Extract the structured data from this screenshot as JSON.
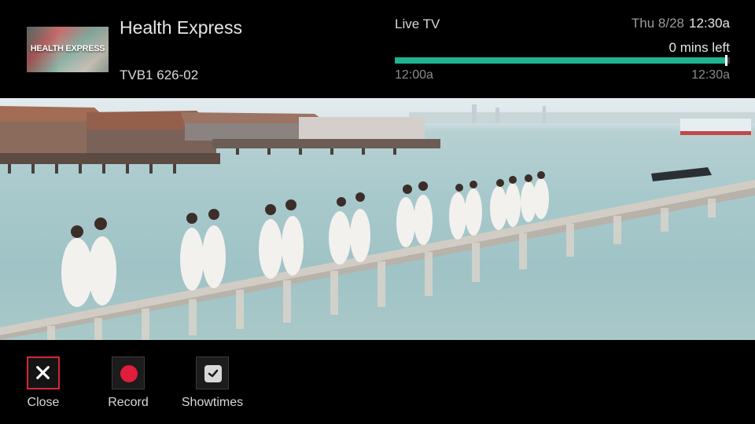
{
  "header": {
    "thumbnail_text": "HEALTH EXPRESS",
    "show_title": "Health Express",
    "channel_info": "TVB1 626-02",
    "live_label": "Live TV",
    "date": "Thu 8/28",
    "time": "12:30a",
    "remaining": "0 mins left",
    "start_time": "12:00a",
    "end_time": "12:30a",
    "progress": 0.99
  },
  "video": {
    "icon": "live-video-frame"
  },
  "actions": [
    {
      "label": "Close",
      "icon": "close-icon",
      "selected": true
    },
    {
      "label": "Record",
      "icon": "record-icon",
      "selected": false
    },
    {
      "label": "Showtimes",
      "icon": "showtimes-icon",
      "selected": false
    }
  ],
  "colors": {
    "accent": "#1fb391",
    "record": "#e01d3a",
    "selected_border": "#d8263a"
  }
}
